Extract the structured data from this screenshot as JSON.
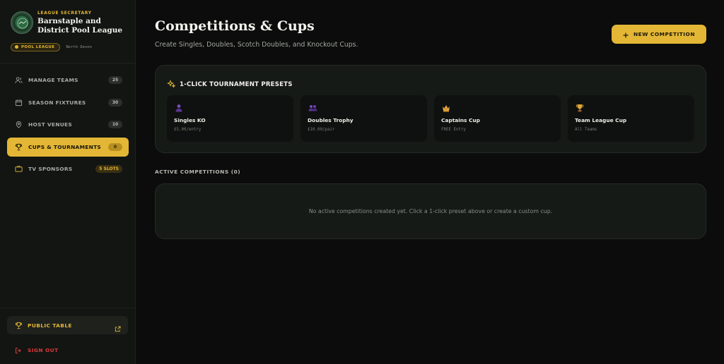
{
  "sidebar": {
    "role": "LEAGUE SECRETARY",
    "league_name": "Barnstaple and District Pool League",
    "league_badge": "POOL LEAGUE",
    "region": "North Devon",
    "items": [
      {
        "label": "MANAGE TEAMS",
        "count": "25",
        "icon": "users-icon"
      },
      {
        "label": "SEASON FIXTURES",
        "count": "30",
        "icon": "calendar-icon"
      },
      {
        "label": "HOST VENUES",
        "count": "10",
        "icon": "map-pin-icon"
      },
      {
        "label": "CUPS & TOURNAMENTS",
        "count": "0",
        "icon": "trophy-icon",
        "active": true
      },
      {
        "label": "TV SPONSORS",
        "count": "5 SLOTS",
        "icon": "tv-icon"
      }
    ],
    "public_table": "PUBLIC TABLE",
    "sign_out": "SIGN OUT"
  },
  "main": {
    "title": "Competitions & Cups",
    "subtitle": "Create Singles, Doubles, Scotch Doubles, and Knockout Cups.",
    "new_button": "NEW COMPETITION",
    "presets": {
      "title": "1-CLICK TOURNAMENT PRESETS",
      "items": [
        {
          "name": "Singles KO",
          "meta": "£5.00/entry",
          "icon": "person-icon"
        },
        {
          "name": "Doubles Trophy",
          "meta": "£10.00/pair",
          "icon": "pair-icon"
        },
        {
          "name": "Captains Cup",
          "meta": "FREE Entry",
          "icon": "crown-icon"
        },
        {
          "name": "Team League Cup",
          "meta": "All Teams",
          "icon": "trophy-icon"
        }
      ]
    },
    "active": {
      "title": "ACTIVE COMPETITIONS (0)",
      "empty_message": "No active competitions created yet. Click a 1-click preset above or create a custom cup."
    }
  },
  "colors": {
    "accent": "#e3b635",
    "background": "#0b0c0b",
    "sidebar": "#121512",
    "danger": "#d6393a"
  }
}
